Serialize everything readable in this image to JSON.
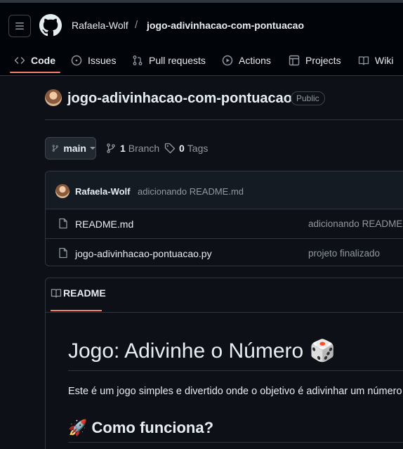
{
  "nav": {
    "owner": "Rafaela-Wolf",
    "separator": "/",
    "repo": "jogo-adivinhacao-com-pontuacao",
    "tabs": [
      {
        "label": "Code",
        "icon": "code-icon"
      },
      {
        "label": "Issues",
        "icon": "issue-icon"
      },
      {
        "label": "Pull requests",
        "icon": "pull-request-icon"
      },
      {
        "label": "Actions",
        "icon": "play-icon"
      },
      {
        "label": "Projects",
        "icon": "table-icon"
      },
      {
        "label": "Wiki",
        "icon": "book-icon"
      }
    ]
  },
  "repo": {
    "title": "jogo-adivinhacao-com-pontuacao",
    "visibility": "Public"
  },
  "branch": {
    "current": "main",
    "branch_count": "1",
    "branch_label": "Branch",
    "tag_count": "0",
    "tag_label": "Tags"
  },
  "latest_commit": {
    "author": "Rafaela-Wolf",
    "message": "adicionando README.md"
  },
  "files": [
    {
      "name": "README.md",
      "commit": "adicionando README.md",
      "icon": "file-icon"
    },
    {
      "name": "jogo-adivinhacao-pontuacao.py",
      "commit": "projeto finalizado",
      "icon": "file-icon"
    }
  ],
  "readme": {
    "tab_label": "README",
    "h1": "Jogo: Adivinhe o Número 🎲",
    "paragraph": "Este é um jogo simples e divertido onde o objetivo é adivinhar um número",
    "h2": "🚀 Como funciona?"
  },
  "colors": {
    "background": "#0d1117",
    "header": "#010409",
    "accent_underline": "#f78166",
    "border": "#30363d",
    "muted_text": "#9198a1"
  }
}
